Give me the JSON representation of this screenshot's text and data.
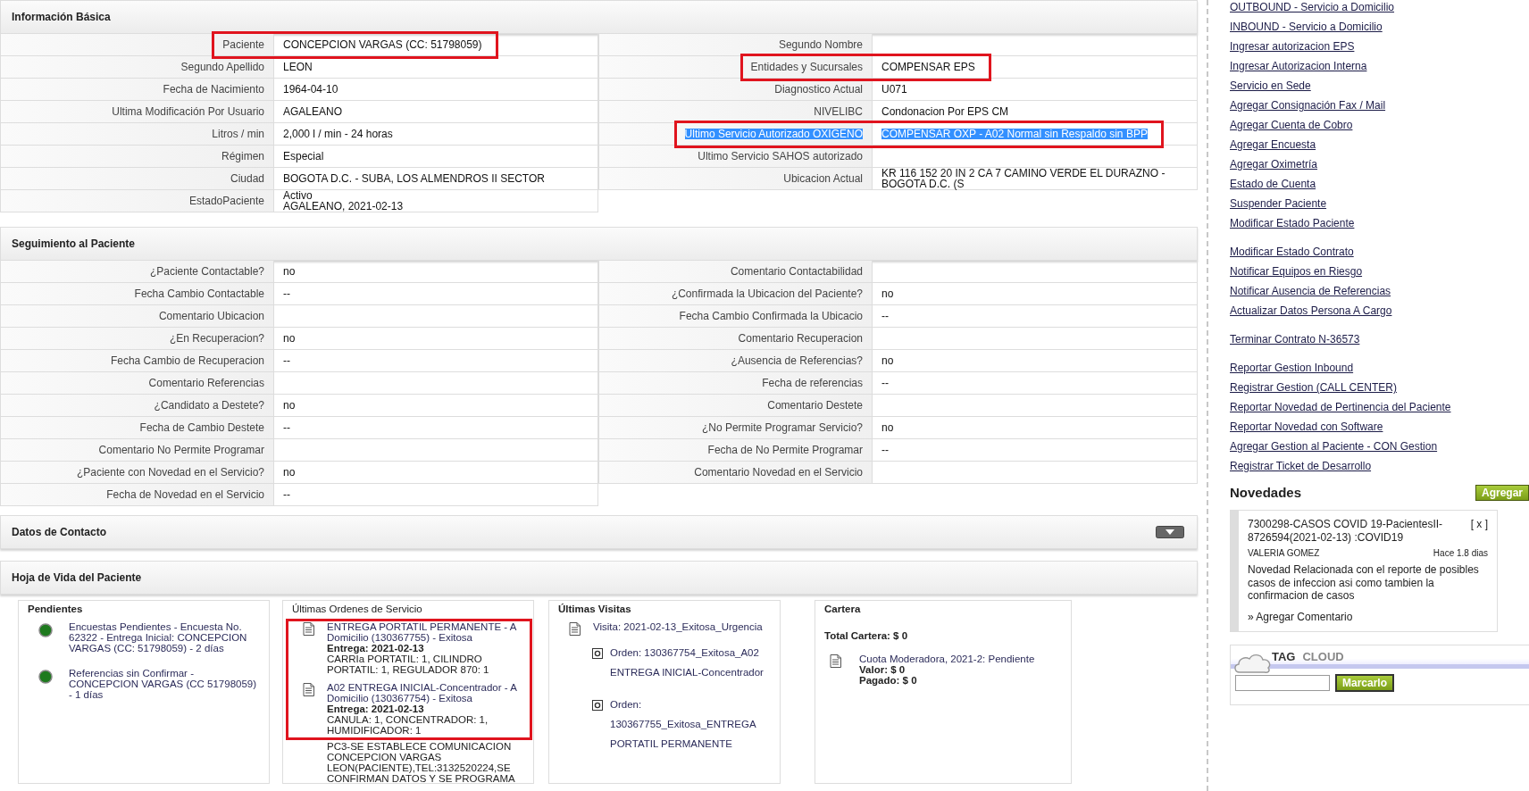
{
  "info_basica": {
    "title": "Información Básica",
    "left": [
      {
        "label": "Paciente",
        "value": "CONCEPCION VARGAS (CC: 51798059)",
        "marked": true,
        "text_selected": false
      },
      {
        "label": "Segundo Apellido",
        "value": "LEON",
        "marked": false,
        "text_selected": false
      },
      {
        "label": "Fecha de Nacimiento",
        "value": "1964-04-10",
        "marked": false,
        "text_selected": false
      },
      {
        "label": "Ultima Modificación Por Usuario",
        "value": "AGALEANO",
        "marked": false,
        "text_selected": false
      },
      {
        "label": "Litros / min",
        "value": "2,000 l / min - 24 horas",
        "marked": false,
        "text_selected": false
      },
      {
        "label": "Régimen",
        "value": "Especial",
        "marked": false,
        "text_selected": false
      },
      {
        "label": "Ciudad",
        "value": "BOGOTA D.C. - SUBA, LOS ALMENDROS II SECTOR",
        "marked": false,
        "text_selected": false
      },
      {
        "label": "EstadoPaciente",
        "value": "Activo\nAGALEANO, 2021-02-13",
        "marked": false,
        "text_selected": false
      }
    ],
    "right": [
      {
        "label": "Segundo Nombre",
        "marked": false,
        "text_selected": false
      },
      {
        "label": "Entidades y Sucursales",
        "value": "COMPENSAR EPS",
        "marked": true,
        "text_selected": false
      },
      {
        "label": "Diagnostico Actual",
        "value": "U071",
        "marked": false,
        "text_selected": false
      },
      {
        "label": "NIVELIBC",
        "value": "Condonacion Por EPS CM",
        "marked": false,
        "text_selected": false
      },
      {
        "label": "Ultimo Servicio Autorizado OXIGENO",
        "value": "COMPENSAR OXP - A02 Normal sin Respaldo sin BPP",
        "marked": true,
        "text_selected": true
      },
      {
        "label": "Ultimo Servicio SAHOS autorizado",
        "marked": false,
        "text_selected": false
      },
      {
        "label": "Ubicacion Actual",
        "value": "KR 116 152 20 IN 2 CA 7 CAMINO VERDE EL DURAZNO - BOGOTA D.C. (S",
        "marked": false,
        "text_selected": false
      }
    ]
  },
  "seguimiento": {
    "title": "Seguimiento al Paciente",
    "left": [
      {
        "label": "¿Paciente Contactable?",
        "value": "no"
      },
      {
        "label": "Fecha Cambio Contactable",
        "value": "--"
      },
      {
        "label": "Comentario Ubicacion"
      },
      {
        "label": "¿En Recuperacion?",
        "value": "no"
      },
      {
        "label": "Fecha Cambio de Recuperacion",
        "value": "--"
      },
      {
        "label": "Comentario Referencias"
      },
      {
        "label": "¿Candidato a Destete?",
        "value": "no"
      },
      {
        "label": "Fecha de Cambio Destete",
        "value": "--"
      },
      {
        "label": "Comentario No Permite Programar"
      },
      {
        "label": "¿Paciente con Novedad en el Servicio?",
        "value": "no"
      },
      {
        "label": "Fecha de Novedad en el Servicio",
        "value": "--"
      }
    ],
    "right": [
      {
        "label": "Comentario Contactabilidad"
      },
      {
        "label": "¿Confirmada la Ubicacion del Paciente?",
        "value": "no"
      },
      {
        "label": "Fecha Cambio Confirmada la Ubicacio",
        "value": "--"
      },
      {
        "label": "Comentario Recuperacion"
      },
      {
        "label": "¿Ausencia de Referencias?",
        "value": "no"
      },
      {
        "label": "Fecha de referencias",
        "value": "--"
      },
      {
        "label": "Comentario Destete"
      },
      {
        "label": "¿No Permite Programar Servicio?",
        "value": "no"
      },
      {
        "label": "Fecha de No Permite Programar",
        "value": "--"
      },
      {
        "label": "Comentario Novedad en el Servicio"
      }
    ]
  },
  "datos_contacto": {
    "title": "Datos de Contacto",
    "expanded": false
  },
  "hoja_de_vida": {
    "title": "Hoja de Vida del Paciente",
    "pendientes": {
      "title": "Pendientes",
      "items": [
        {
          "text": "Encuestas Pendientes - Encuesta No. 62322 - Entrega Inicial: CONCEPCION VARGAS (CC: 51798059) - 2 días",
          "color": "#1e7a1e"
        },
        {
          "text": "Referencias sin Confirmar - CONCEPCION VARGAS (CC 51798059) - 1 días",
          "color": "#1e7a1e"
        }
      ]
    },
    "ordenes": {
      "title": "Últimas Ordenes de Servicio",
      "marked": true,
      "items": [
        {
          "title": "ENTREGA PORTATIL PERMANENTE - A Domicilio (130367755) - Exitosa",
          "entrega": "Entrega: 2021-02-13",
          "detail": "CARRIa PORTATIL: 1, CILINDRO PORTATIL: 1, REGULADOR 870: 1"
        },
        {
          "title": "A02 ENTREGA INICIAL-Concentrador - A Domicilio (130367754) - Exitosa",
          "entrega": "Entrega: 2021-02-13",
          "detail": "CANULA: 1, CONCENTRADOR: 1, HUMIDIFICADOR: 1",
          "note": "PC3-SE ESTABLECE COMUNICACION CONCEPCION VARGAS LEON(PACIENTE),TEL:3132520224,SE CONFIRMAN DATOS Y SE PROGRAMA"
        }
      ]
    },
    "visitas": {
      "title": "Últimas Visitas",
      "items": [
        {
          "text": "Visita: 2021-02-13_Exitosa_Urgencia",
          "children": [
            {
              "text": "Orden: 130367754_Exitosa_A02 ENTREGA INICIAL-Concentrador"
            },
            {
              "text": "Orden: 130367755_Exitosa_ENTREGA PORTATIL PERMANENTE"
            }
          ]
        }
      ]
    },
    "cartera": {
      "title": "Cartera",
      "total": "Total Cartera: $ 0",
      "items": [
        {
          "title": "Cuota Moderadora, 2021-2: Pendiente",
          "valor": "Valor: $ 0",
          "pagado": "Pagado: $ 0"
        }
      ]
    }
  },
  "sidebar": {
    "link_groups": [
      {
        "links": [
          "OUTBOUND - Servicio a Domicilio",
          "INBOUND - Servicio a Domicilio",
          "Ingresar autorizacion EPS",
          "Ingresar Autorizacion Interna",
          "Servicio en Sede",
          "Agregar Consignación Fax / Mail",
          "Agregar Cuenta de Cobro",
          "Agregar Encuesta",
          "Agregar Oximetría",
          "Estado de Cuenta",
          "Suspender Paciente",
          "Modificar Estado Paciente"
        ]
      },
      {
        "links": [
          "Modificar Estado Contrato",
          "Notificar Equipos en Riesgo",
          "Notificar Ausencia de Referencias",
          "Actualizar Datos Persona A Cargo"
        ]
      },
      {
        "links": [
          "Terminar Contrato N-36573"
        ]
      },
      {
        "links": [
          "Reportar Gestion Inbound",
          "Registrar Gestion (CALL CENTER)",
          "Reportar Novedad de Pertinencia del Paciente",
          "Reportar Novedad con Software",
          "Agregar Gestion al Paciente - CON Gestion",
          "Registrar Ticket de Desarrollo"
        ]
      }
    ],
    "novedades": {
      "title": "Novedades",
      "add_button": "Agregar",
      "items": [
        {
          "title": "7300298-CASOS COVID 19-PacientesII-8726594(2021-02-13) :COVID19",
          "close": "[ x ]",
          "author": "VALERIA GOMEZ",
          "age": "Hace 1.8 dias",
          "body": "Novedad Relacionada con el reporte de posibles casos de infeccion asi como tambien la confirmacion de casos",
          "comment_link": "» Agregar Comentario"
        }
      ]
    },
    "tag_cloud": {
      "title_main": "TAG",
      "title_accent": "CLOUD",
      "button": "Marcarlo"
    }
  }
}
